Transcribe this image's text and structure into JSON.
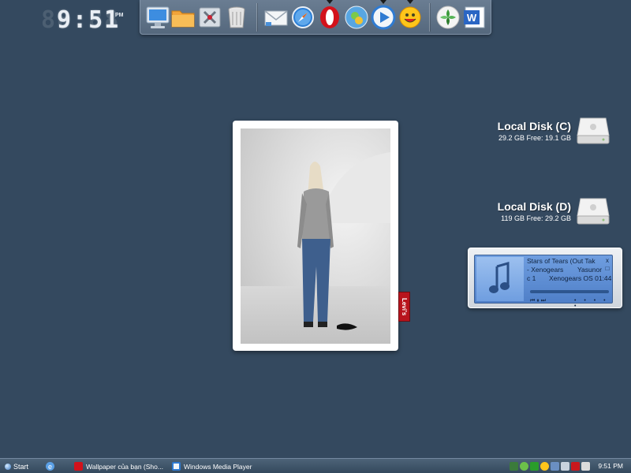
{
  "clock": {
    "time": "9:51",
    "ghost": "88:88",
    "ampm": "PM"
  },
  "dock": {
    "items": [
      {
        "name": "my-computer-icon"
      },
      {
        "name": "folder-icon"
      },
      {
        "name": "control-panel-icon"
      },
      {
        "name": "recycle-bin-icon"
      },
      {
        "name": "mail-icon"
      },
      {
        "name": "safari-compass-icon"
      },
      {
        "name": "opera-icon"
      },
      {
        "name": "messenger-icon"
      },
      {
        "name": "media-player-icon"
      },
      {
        "name": "yahoo-messenger-icon"
      },
      {
        "name": "photo-app-icon"
      },
      {
        "name": "word-icon"
      }
    ]
  },
  "photo_widget": {
    "badge": "Levi's"
  },
  "disks": [
    {
      "name": "Local Disk (C)",
      "info": "29.2 GB Free: 19.1 GB"
    },
    {
      "name": "Local Disk (D)",
      "info": "119 GB Free: 29.2 GB"
    }
  ],
  "player": {
    "title": "Stars of Tears (Out Tak",
    "artist": "- Xenogears",
    "composer": "Yasunor",
    "disc": "c 1",
    "album_time": "Xenogears OS 01:44",
    "close_label": "x",
    "mini_label": "□",
    "controls": "⏮ ⏸ ⏭"
  },
  "taskbar": {
    "start_label": "Start",
    "tasks": [
      {
        "label": "Wallpaper của bạn (Sho..."
      },
      {
        "label": "Windows Media Player"
      }
    ],
    "clock": "9:51 PM"
  },
  "colors": {
    "desktop": "#34495f",
    "taskbar": "#3f566c",
    "levis_red": "#b8141d"
  }
}
